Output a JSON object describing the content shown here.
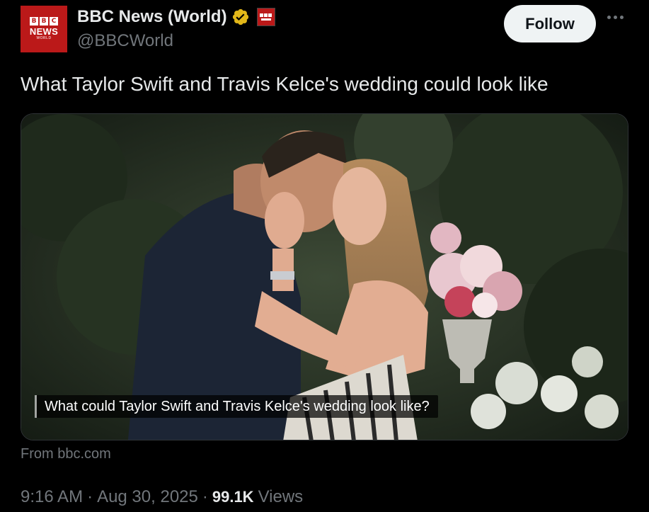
{
  "account": {
    "display_name": "BBC News (World)",
    "handle": "@BBCWorld",
    "avatar_text": {
      "letters": [
        "B",
        "B",
        "C"
      ],
      "news": "NEWS",
      "world": "WORLD"
    },
    "verified_icon": "gold-verified-badge-icon",
    "affiliate_icon": "bbc-news-affiliate-badge-icon"
  },
  "actions": {
    "follow_label": "Follow",
    "more_icon": "more-horizontal-icon"
  },
  "tweet": {
    "text": "What Taylor Swift and Travis Kelce's wedding could look like"
  },
  "card": {
    "caption": "What could Taylor Swift and Travis Kelce's wedding look like?",
    "source": "From bbc.com"
  },
  "meta": {
    "time": "9:16 AM",
    "sep1": "·",
    "date": "Aug 30, 2025",
    "sep2": "·",
    "views_count": "99.1K",
    "views_label": "Views"
  },
  "colors": {
    "background": "#000000",
    "text_primary": "#e7e9ea",
    "text_secondary": "#71767b",
    "bbc_red": "#bb1919",
    "verified_gold": "#e2b719",
    "follow_bg": "#eff3f4"
  }
}
